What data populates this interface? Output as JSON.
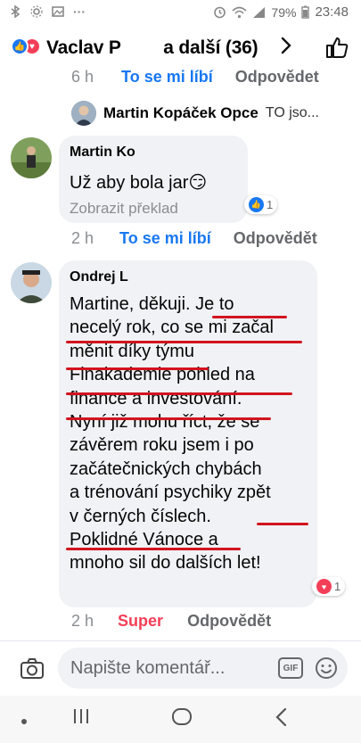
{
  "status_bar": {
    "battery": "79%",
    "time": "23:48"
  },
  "header": {
    "title": "Vaclav P",
    "title_suffix": "a další (36)"
  },
  "top_meta": {
    "time": "6 h",
    "like": "To se mi líbí",
    "reply": "Odpovědet"
  },
  "reply_preview": {
    "name": "Martin Kopáček Opce",
    "text": "TO jso..."
  },
  "comment1": {
    "author": "Martin Ko",
    "text": "Už aby bola jar😏",
    "translate": "Zobrazit překlad",
    "reaction_count": "1",
    "time": "2 h",
    "like": "To se mi líbí",
    "reply": "Odpovědět"
  },
  "comment2": {
    "author": "Ondrej L",
    "lines": [
      "Martine, děkuji. Je to",
      "necelý rok, co se mi začal",
      "měnit díky týmu",
      "Finakademie pohled na",
      "finance a investování.",
      "Nyní již mohu říct,  že se",
      "závěrem roku jsem i po",
      "začátečnických chybách",
      "a trénování psychiky zpět",
      "v černých číslech.",
      "Poklidné Vánoce a",
      "mnoho sil do dalších let!"
    ],
    "reaction_count": "1",
    "time": "2 h",
    "like": "Super",
    "reply": "Odpovědět"
  },
  "composer": {
    "placeholder": "Napište komentář...",
    "gif_label": "GIF"
  },
  "colors": {
    "accent": "#1877f2",
    "love": "#f33e58",
    "underline": "#d2141e"
  }
}
